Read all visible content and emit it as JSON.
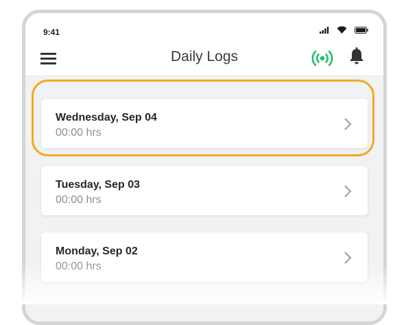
{
  "status_bar": {
    "time": "9:41",
    "icons": [
      "signal-icon",
      "wifi-icon",
      "battery-icon"
    ]
  },
  "header": {
    "title": "Daily Logs",
    "left_icon": "menu-icon",
    "right_icons": [
      "connection-signal-icon",
      "bell-icon"
    ]
  },
  "logs": [
    {
      "day": "Wednesday, Sep 04",
      "hours": "00:00 hrs",
      "highlighted": true
    },
    {
      "day": "Tuesday, Sep 03",
      "hours": "00:00 hrs",
      "highlighted": false
    },
    {
      "day": "Monday, Sep 02",
      "hours": "00:00 hrs",
      "highlighted": false
    }
  ],
  "colors": {
    "accent_green": "#1fbf6b",
    "highlight_orange": "#f4a81d",
    "list_background": "#f1f2f4"
  }
}
